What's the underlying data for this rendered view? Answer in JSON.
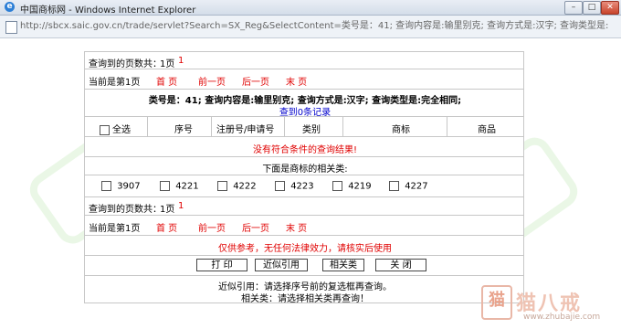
{
  "window": {
    "title": "中国商标网 - Windows Internet Explorer",
    "minimize": "–",
    "maximize": "□",
    "close": "✕"
  },
  "address": {
    "url": "http://sbcx.saic.gov.cn/trade/servlet?Search=SX_Reg&SelectContent=类号是：41; 查询内容是:输里别克; 查询方式是:汉字; 查询类型是:完全相同;&lr"
  },
  "results": {
    "pages_label": "查询到的页数共：",
    "pages_value": "1页",
    "pages_num": "1",
    "current_page": "当前是第1页",
    "nav": [
      "首 页",
      "前一页",
      "后一页",
      "末 页"
    ],
    "query_summary": "类号是：41; 查询内容是:输里别克; 查询方式是:汉字; 查询类型是:完全相同;",
    "record_count": "查到0条记录"
  },
  "table": {
    "select_all": "全选",
    "headers": [
      "序号",
      "注册号/申请号",
      "类别",
      "商标",
      "商品"
    ],
    "no_results": "没有符合条件的查询结果!"
  },
  "related": {
    "label": "下面是商标的相关类:",
    "classes": [
      "3907",
      "4221",
      "4222",
      "4223",
      "4219",
      "4227"
    ]
  },
  "footer": {
    "pages_label": "查询到的页数共：",
    "pages_value": "1页",
    "pages_num": "1",
    "current_page": "当前是第1页",
    "nav": [
      "首 页",
      "前一页",
      "后一页",
      "末 页"
    ],
    "disclaimer": "仅供参考，无任何法律效力，请核实后使用",
    "buttons": [
      "打 印",
      "近似引用",
      "相关类",
      "关 闭"
    ],
    "hint1": "近似引用：请选择序号前的复选框再查询。",
    "hint2": "相关类：请选择相关类再查询！"
  },
  "watermark": {
    "seal": "猫",
    "brand": "猫八戒",
    "site": "www.zhubajie.com"
  }
}
